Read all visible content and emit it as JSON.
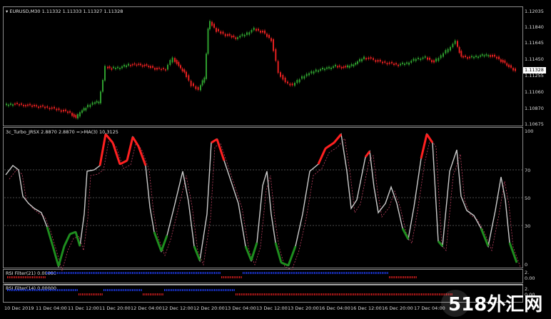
{
  "main_chart": {
    "symbol_label": "EURUSD,M30  1.11332 1.11333 1.11327 1.11328",
    "current_price": "1.11328",
    "price_axis": [
      "1.12035",
      "1.11840",
      "1.11645",
      "1.11450",
      "1.11255",
      "1.11060",
      "1.10870",
      "1.10675"
    ],
    "bull_color": "#2e9e2e",
    "bear_color": "#e62020"
  },
  "indicator1": {
    "label": "3c_Turbo_JRSX 2.8870 2.8870  =>MA(3) 10.3125",
    "levels": [
      "100",
      "70",
      "50",
      "30",
      "0"
    ],
    "line_color": "#cccccc",
    "ma_color": "#c04060",
    "high_color": "#ff2020",
    "low_color": "#1e8e1e"
  },
  "indicator2": {
    "label": "RSI Filter(21) 0.00000",
    "axis": [
      "2.",
      "0.00"
    ],
    "up_color": "#2040ff",
    "down_color": "#e02020"
  },
  "indicator3": {
    "label": "RSI Filter(14) 0.00000",
    "axis": [
      "2.",
      "0.00"
    ],
    "up_color": "#2040ff",
    "down_color": "#e02020"
  },
  "time_axis": [
    "10 Dec 2019",
    "11 Dec 04:00",
    "11 Dec 12:00",
    "11 Dec 20:00",
    "12 Dec 04:00",
    "12 Dec 12:00",
    "12 Dec 20:00",
    "13 Dec 04:00",
    "13 Dec 12:00",
    "13 Dec 20:00",
    "16 Dec 04:00",
    "16 Dec 12:00",
    "16 Dec 20:00",
    "17 Dec 04:00"
  ],
  "watermark": "518外汇网"
}
